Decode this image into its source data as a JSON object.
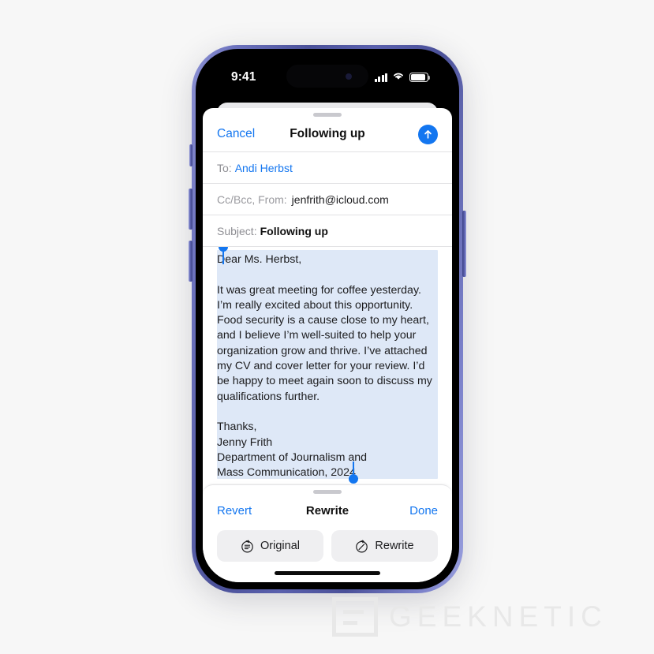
{
  "status_bar": {
    "time": "9:41",
    "cellular_icon": "cellular-signal-icon",
    "wifi_icon": "wifi-icon",
    "battery_icon": "battery-icon"
  },
  "compose": {
    "cancel_label": "Cancel",
    "title": "Following up",
    "send_icon": "send-arrow-up-icon",
    "fields": {
      "to_label": "To:",
      "to_value": "Andi Herbst",
      "cc_label": "Cc/Bcc, From:",
      "cc_value": "jenfrith@icloud.com",
      "subject_label": "Subject:",
      "subject_value": "Following up"
    },
    "body": "Dear Ms. Herbst,\n\nIt was great meeting for coffee yesterday. I’m really excited about this opportunity. Food security is a cause close to my heart, and I believe I’m well-suited to help your organization grow and thrive. I’ve attached my CV and cover letter for your review. I’d be happy to meet again soon to discuss my qualifications further.\n\nThanks,\nJenny Frith\nDepartment of Journalism and\nMass Communication, 2024"
  },
  "rewrite_panel": {
    "revert_label": "Revert",
    "title": "Rewrite",
    "done_label": "Done",
    "actions": [
      {
        "label": "Original",
        "icon": "original-text-circle-icon"
      },
      {
        "label": "Rewrite",
        "icon": "rewrite-wand-circle-icon"
      }
    ]
  },
  "watermark": {
    "text": "GEEKNETIC",
    "logo_icon": "geeknetic-logo-icon"
  },
  "colors": {
    "accent_blue": "#1376f0",
    "selection_highlight": "#dee8f7",
    "chip_background": "#efeff1",
    "page_background": "#f7f7f7",
    "phone_frame": "#5a60ad"
  }
}
